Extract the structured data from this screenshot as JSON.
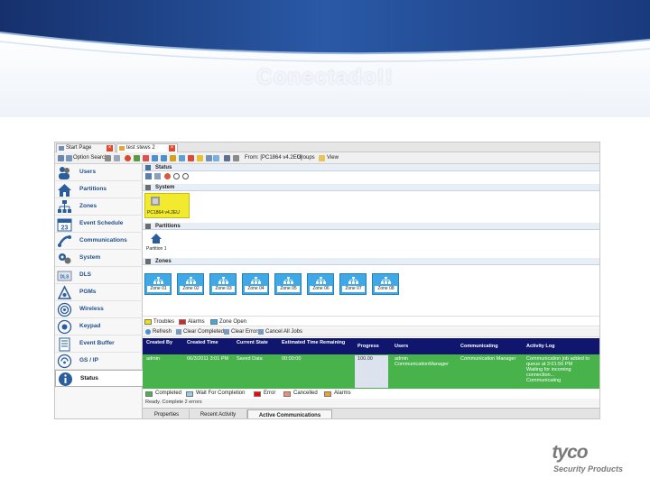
{
  "slide": {
    "title": "Conectado!!"
  },
  "tabs": [
    {
      "label": "Start Page"
    },
    {
      "label": "test stews 2"
    }
  ],
  "toolbar": {
    "option_search": "Option Search",
    "from": "From: [PC1864 v4.2EU]",
    "groups": "Groups",
    "view": "View"
  },
  "nav": {
    "items": [
      {
        "label": "Users"
      },
      {
        "label": "Partitions"
      },
      {
        "label": "Zones"
      },
      {
        "label": "Event Schedule",
        "badge": "23"
      },
      {
        "label": "Communications"
      },
      {
        "label": "System"
      },
      {
        "label": "DLS"
      },
      {
        "label": "PGMs"
      },
      {
        "label": "Wireless"
      },
      {
        "label": "Keypad"
      },
      {
        "label": "Event Buffer"
      },
      {
        "label": "GS / IP"
      },
      {
        "label": "Status"
      }
    ]
  },
  "main": {
    "status_header": "Status",
    "system_header": "System",
    "system_panel": "PC1864 v4.2EU",
    "partitions_header": "Partitions",
    "partition_label": "Partition 1",
    "zones_header": "Zones",
    "zones": [
      "Zone 01",
      "Zone 02",
      "Zone 03",
      "Zone 04",
      "Zone 05",
      "Zone 06",
      "Zone 07",
      "Zone 08"
    ],
    "legend": {
      "troubles": "Troubles",
      "alarms": "Alarms",
      "zone_open": "Zone Open"
    },
    "commands": {
      "refresh": "Refresh",
      "clear_completed": "Clear Completed",
      "clear_errors": "Clear Errors",
      "cancel_all": "Cancel All Jobs"
    },
    "grid": {
      "headers": [
        "Created By",
        "Created Time",
        "Current State",
        "Estimated Time Remaining",
        "Progress",
        "Users",
        "Communicating",
        "Activity Log"
      ],
      "row": {
        "created_by": "admin",
        "created_time": "06/3/2011 3:01 PM",
        "state": "Saved Data",
        "remaining": "00:00:00",
        "progress": "100.00",
        "users": "admin\nCommunicationManager",
        "communicating": "Communication Manager",
        "log": "Communication job added to\nqueue at 3:01:56 PM\nWaiting for incoming\nconnection...\nCommunicating"
      }
    },
    "status_legend": [
      "Completed",
      "Wait For Completion",
      "Error",
      "Cancelled",
      "Alarms"
    ],
    "status_line": "Ready. Complete 2 errors",
    "bottom_tabs": [
      "Properties",
      "Recent Activity",
      "Active Communications"
    ]
  },
  "logo": {
    "word": "tyco",
    "sub": "Security Products"
  },
  "colors": {
    "accent_blue": "#10166d",
    "row_green": "#48b24b",
    "zone_blue": "#3fa8e6",
    "trouble_yellow": "#f2e200",
    "alarm_red": "#e02020",
    "error_red": "#ff0000",
    "cancelled_salmon": "#f48c70",
    "alarms_orange": "#f0a030",
    "wait_lightblue": "#8fd0f0"
  }
}
